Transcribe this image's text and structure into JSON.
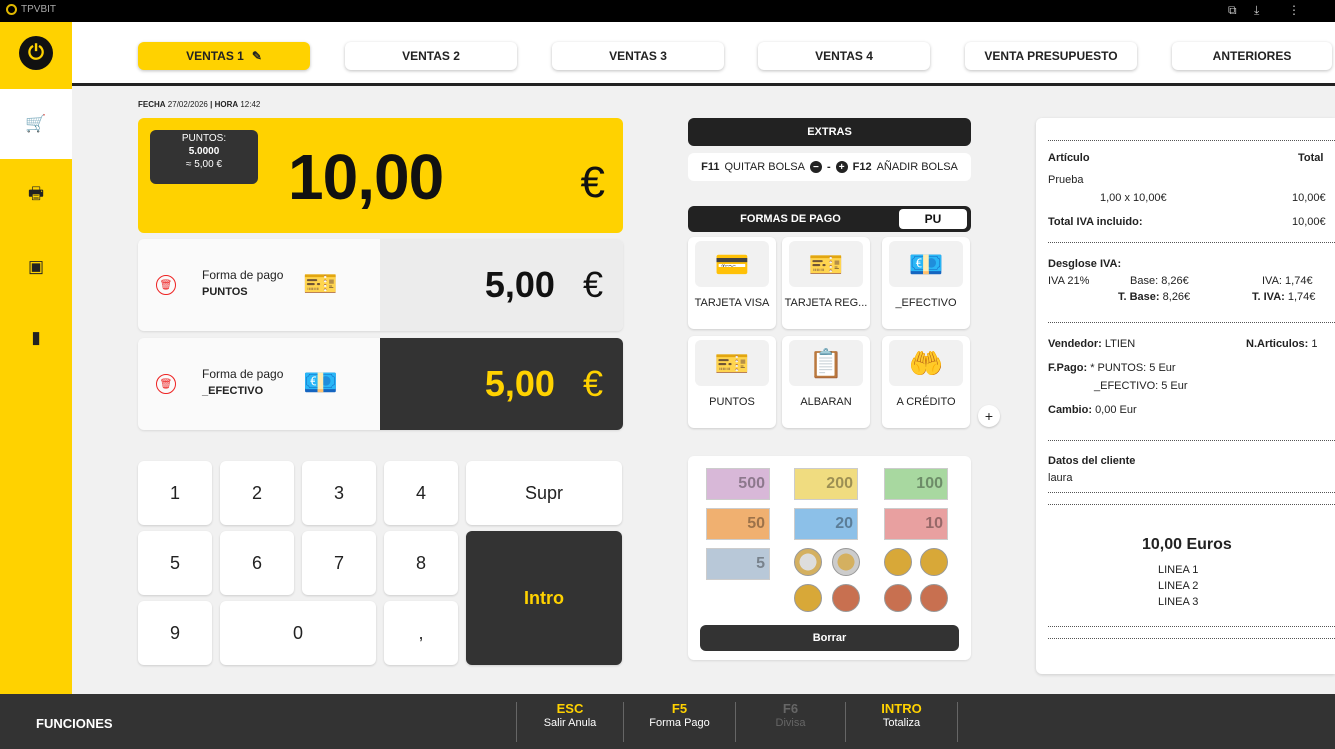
{
  "titlebar": {
    "app": "TPVBIT",
    "icons": [
      "extension-icon",
      "download-icon",
      "more-icon"
    ]
  },
  "sidebar": {
    "items": [
      "power-icon",
      "cart-icon",
      "register-icon",
      "cash-icon",
      "door-icon"
    ],
    "active": 1
  },
  "tabs": [
    {
      "label": "VENTAS 1",
      "active": true,
      "icon": "pencil-icon"
    },
    {
      "label": "VENTAS 2"
    },
    {
      "label": "VENTAS 3"
    },
    {
      "label": "VENTAS 4"
    },
    {
      "label": "VENTA PRESUPUESTO"
    },
    {
      "label": "ANTERIORES"
    }
  ],
  "datetime": {
    "fecha_label": "FECHA",
    "fecha": "27/02/2026",
    "sep": "|",
    "hora_label": "HORA",
    "hora": "12:42"
  },
  "total": {
    "points_label": "PUNTOS:",
    "points": "5.0000",
    "points_eq": "≈ 5,00 €",
    "amount": "10,00",
    "currency": "€"
  },
  "payments": [
    {
      "label": "Forma de pago",
      "method": "PUNTOS",
      "amount": "5,00",
      "currency": "€"
    },
    {
      "label": "Forma de pago",
      "method": "_EFECTIVO",
      "amount": "5,00",
      "currency": "€"
    }
  ],
  "keypad": {
    "k1": "1",
    "k2": "2",
    "k3": "3",
    "k4": "4",
    "supr": "Supr",
    "k5": "5",
    "k6": "6",
    "k7": "7",
    "k8": "8",
    "intro": "Intro",
    "k9": "9",
    "k0": "0",
    "comma": ","
  },
  "extras": {
    "title": "EXTRAS",
    "f11": "F11",
    "quitar": "QUITAR BOLSA",
    "dash": "-",
    "f12": "F12",
    "anadir": "AÑADIR BOLSA"
  },
  "formas": {
    "title": "FORMAS DE PAGO",
    "pu": "PU",
    "methods": [
      {
        "label": "TARJETA VISA",
        "icon": "card-icon"
      },
      {
        "label": "TARJETA REG...",
        "icon": "gift-card-icon"
      },
      {
        "label": "_EFECTIVO",
        "icon": "cash-icon"
      },
      {
        "label": "PUNTOS",
        "icon": "gift-card-icon"
      },
      {
        "label": "ALBARAN",
        "icon": "clipboard-icon"
      },
      {
        "label": "A CRÉDITO",
        "icon": "credit-hand-icon"
      }
    ],
    "plus": "+"
  },
  "money": {
    "notes": [
      "500",
      "200",
      "100",
      "50",
      "20",
      "10",
      "5"
    ],
    "coins": [
      "2 €",
      "1 €",
      "0,50 €",
      "0,20 €",
      "0,10 €",
      "0,05 €",
      "0,02 €",
      "0,01 €"
    ],
    "colors": {
      "500": "#d8b8d8",
      "200": "#f0dc80",
      "100": "#a8d8a0",
      "50": "#f0b070",
      "20": "#8cc0e8",
      "10": "#e8a0a0",
      "5": "#b8c8d8"
    },
    "borrar": "Borrar"
  },
  "receipt": {
    "articulo_h": "Artículo",
    "total_h": "Total",
    "item_name": "Prueba",
    "item_qty": "1,00 x 10,00€",
    "item_total": "10,00€",
    "iva_incl_label": "Total IVA incluido:",
    "iva_incl": "10,00€",
    "desglose": "Desglose IVA:",
    "iva_rate": "IVA 21%",
    "base_label": "Base:",
    "base": "8,26€",
    "iva_label": "IVA:",
    "iva": "1,74€",
    "tbase_label": "T. Base:",
    "tbase": "8,26€",
    "tiva_label": "T. IVA:",
    "tiva": "1,74€",
    "vendedor_label": "Vendedor:",
    "vendedor": "LTIEN",
    "narticulos_label": "N.Articulos:",
    "narticulos": "1",
    "fpago_label": "F.Pago:",
    "fpago1": "* PUNTOS: 5 Eur",
    "fpago2": "_EFECTIVO: 5 Eur",
    "cambio_label": "Cambio:",
    "cambio": "0,00 Eur",
    "cliente_label": "Datos del cliente",
    "cliente": "laura",
    "total": "10,00 Euros",
    "lineas": [
      "LINEA 1",
      "LINEA 2",
      "LINEA 3"
    ]
  },
  "footer": {
    "label": "FUNCIONES",
    "keys": [
      {
        "key": "ESC",
        "desc": "Salir Anula",
        "enabled": true
      },
      {
        "key": "F5",
        "desc": "Forma Pago",
        "enabled": true
      },
      {
        "key": "F6",
        "desc": "Divisa",
        "enabled": false
      },
      {
        "key": "INTRO",
        "desc": "Totaliza",
        "enabled": true
      }
    ]
  },
  "colors": {
    "accent": "#ffd200",
    "dark": "#333333",
    "danger": "#e22222"
  }
}
